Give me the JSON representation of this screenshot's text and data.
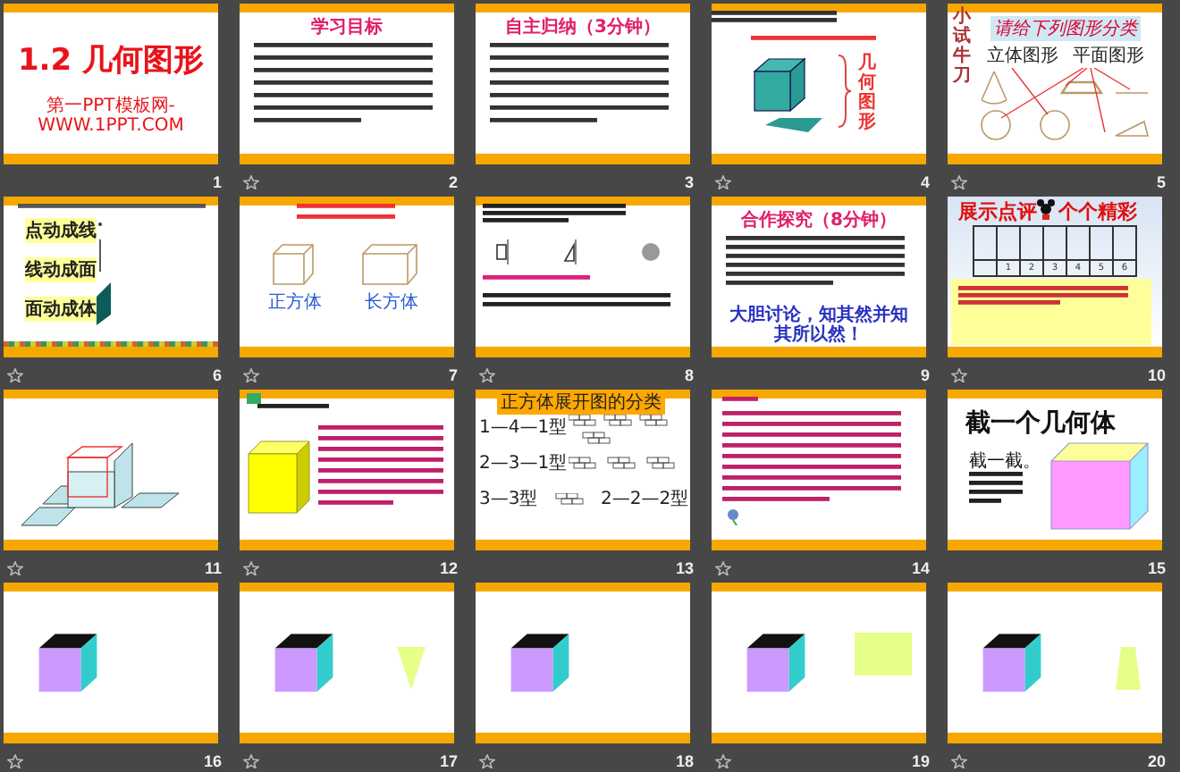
{
  "slides": [
    {
      "number": "1",
      "animated": false,
      "kind": "title",
      "title": "1.2 几何图形",
      "subtitle": "第一PPT模板网-WWW.1PPT.COM"
    },
    {
      "number": "2",
      "animated": true,
      "kind": "text",
      "title": "学习目标"
    },
    {
      "number": "3",
      "animated": false,
      "kind": "text",
      "title": "自主归纳（3分钟）"
    },
    {
      "number": "4",
      "animated": true,
      "kind": "classify",
      "caption": "几何图形"
    },
    {
      "number": "5",
      "animated": true,
      "kind": "sort",
      "side_title": "小试牛刀",
      "prompt": "请给下列图形分类",
      "labels": [
        "立体图形",
        "平面图形"
      ]
    },
    {
      "number": "6",
      "animated": true,
      "kind": "motion",
      "labels": [
        "点动成线",
        "线动成面",
        "面动成体"
      ]
    },
    {
      "number": "7",
      "animated": true,
      "kind": "boxes",
      "labels": [
        "正方体",
        "长方体"
      ]
    },
    {
      "number": "8",
      "animated": true,
      "kind": "example"
    },
    {
      "number": "9",
      "animated": false,
      "kind": "text",
      "title": "合作探究（8分钟）",
      "closing": "大胆讨论，知其然并知其所以然！"
    },
    {
      "number": "10",
      "animated": true,
      "kind": "table",
      "title_left": "展示点评",
      "title_right": "个个精彩",
      "scores": [
        "1",
        "2",
        "3",
        "4",
        "5",
        "6"
      ]
    },
    {
      "number": "11",
      "animated": true,
      "kind": "net"
    },
    {
      "number": "12",
      "animated": true,
      "kind": "cube"
    },
    {
      "number": "13",
      "animated": false,
      "kind": "nets",
      "title": "正方体展开图的分类",
      "types": [
        "1—4—1型",
        "2—3—1型",
        "3—3型",
        "2—2—2型"
      ]
    },
    {
      "number": "14",
      "animated": true,
      "kind": "notes"
    },
    {
      "number": "15",
      "animated": false,
      "kind": "section",
      "title": "截一个几何体",
      "lead": "截一截。"
    },
    {
      "number": "16",
      "animated": true,
      "kind": "cube_cut"
    },
    {
      "number": "17",
      "animated": true,
      "kind": "triangle_cut"
    },
    {
      "number": "18",
      "animated": true,
      "kind": "cube_cut"
    },
    {
      "number": "19",
      "animated": true,
      "kind": "rectangle_cut"
    },
    {
      "number": "20",
      "animated": true,
      "kind": "trapezoid_cut"
    }
  ]
}
